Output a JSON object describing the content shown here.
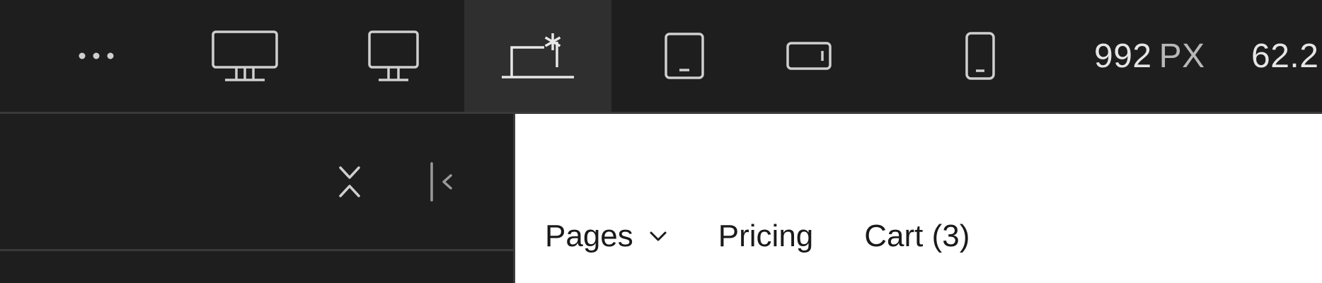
{
  "toolbar": {
    "breakpoints": [
      {
        "icon": "desktop-large-icon",
        "active": false
      },
      {
        "icon": "desktop-icon",
        "active": false
      },
      {
        "icon": "laptop-base-breakpoint-icon",
        "active": true
      },
      {
        "icon": "tablet-icon",
        "active": false
      },
      {
        "icon": "mobile-landscape-icon",
        "active": false
      },
      {
        "icon": "mobile-portrait-icon",
        "active": false
      }
    ],
    "width_value": "992",
    "width_unit": "PX",
    "zoom_value": "62.2"
  },
  "panel": {
    "icons": [
      "collapse-all-icon",
      "collapse-sidebar-icon"
    ]
  },
  "canvas": {
    "nav": {
      "pages_label": "Pages",
      "pricing_label": "Pricing",
      "cart_label": "Cart (3)"
    }
  },
  "colors": {
    "toolbar_bg": "#1e1e1e",
    "active_bg": "#2f2f2f",
    "icon": "#cfcfcf",
    "divider": "#3a3a3a",
    "canvas_bg": "#ffffff",
    "nav_text": "#1a1a1a"
  }
}
